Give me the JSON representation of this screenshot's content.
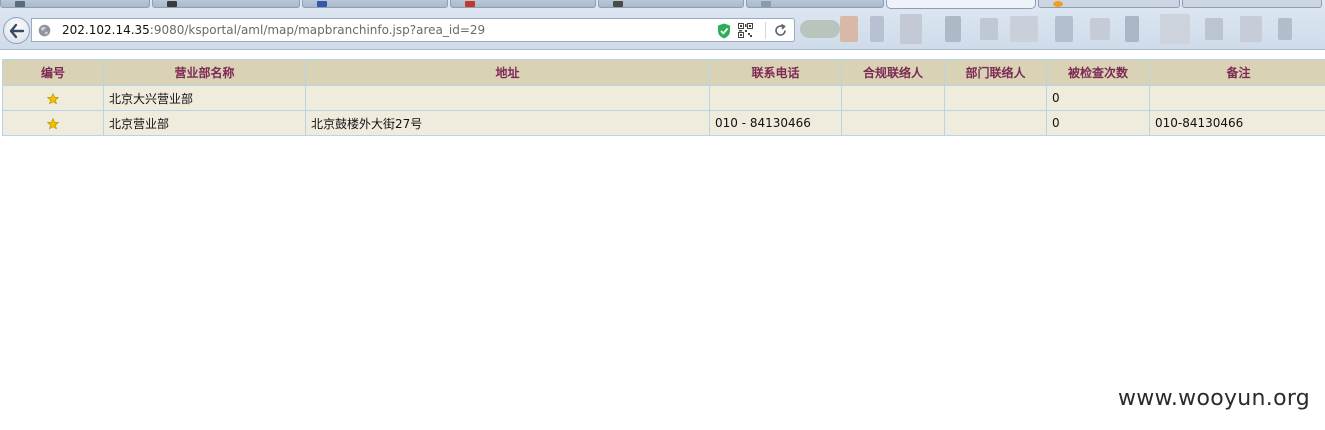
{
  "browser": {
    "url_host": "202.102.14.35",
    "url_rest": ":9080/ksportal/aml/map/mapbranchinfo.jsp?area_id=29",
    "tab_favicon_colors": [
      "#5a6b80",
      "#3b3b3b",
      "#3557a8",
      "#c0392b",
      "#4a4a4a",
      "#8a9ab0"
    ]
  },
  "table": {
    "headers": [
      "编号",
      "营业部名称",
      "地址",
      "联系电话",
      "合规联络人",
      "部门联络人",
      "被检查次数",
      "备注"
    ],
    "rows": [
      {
        "name": "北京大兴营业部",
        "address": "",
        "phone": "",
        "compliance_contact": "",
        "dept_contact": "",
        "inspections": "0",
        "remark": ""
      },
      {
        "name": "北京营业部",
        "address": "北京鼓楼外大街27号",
        "phone": "010 - 84130466",
        "compliance_contact": "",
        "dept_contact": "",
        "inspections": "0",
        "remark": "010-84130466"
      }
    ]
  },
  "colors": {
    "header_bg": "#dad2b4",
    "header_text": "#7d2a56",
    "row_bg": "#efebdd",
    "grid_border": "#b6d5e6",
    "star": "#f2c200"
  },
  "icons": {
    "back": "back-arrow-icon",
    "site": "globe-icon",
    "security": "shield-icon",
    "qr": "qr-code-icon",
    "reload": "reload-icon",
    "row_marker": "star-icon"
  },
  "watermark": "www.wooyun.org"
}
